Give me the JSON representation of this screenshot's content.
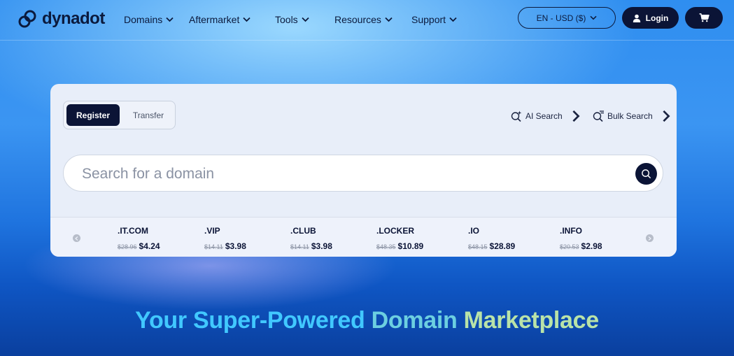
{
  "header": {
    "logo_text": "dynadot",
    "nav": [
      {
        "label": "Domains"
      },
      {
        "label": "Aftermarket"
      },
      {
        "label": "Tools"
      },
      {
        "label": "Resources"
      },
      {
        "label": "Support"
      }
    ],
    "language_currency": "EN - USD ($)",
    "login_label": "Login"
  },
  "search_card": {
    "tabs": {
      "register": "Register",
      "transfer": "Transfer",
      "active": "register"
    },
    "ai_search_label": "AI Search",
    "bulk_search_label": "Bulk Search",
    "search_placeholder": "Search for a domain",
    "tlds": [
      {
        "name": ".IT.COM",
        "old_price": "$28.96",
        "price": "$4.24"
      },
      {
        "name": ".VIP",
        "old_price": "$14.11",
        "price": "$3.98"
      },
      {
        "name": ".CLUB",
        "old_price": "$14.11",
        "price": "$3.98"
      },
      {
        "name": ".LOCKER",
        "old_price": "$48.35",
        "price": "$10.89"
      },
      {
        "name": ".IO",
        "old_price": "$48.15",
        "price": "$28.89"
      },
      {
        "name": ".INFO",
        "old_price": "$20.53",
        "price": "$2.98"
      }
    ]
  },
  "headline": {
    "part1": "Your Super-Powered ",
    "part2": "Domain ",
    "part3": "Marketplace"
  },
  "colors": {
    "navy": "#0b1436",
    "card_bg": "#e8eef9",
    "headline_blue": "#41c8ff",
    "headline_green": "#b9e3a8"
  },
  "icons": [
    "dynadot-logo-icon",
    "chevron-down-icon",
    "user-icon",
    "cart-icon",
    "ai-search-icon",
    "bulk-search-icon",
    "chevron-right-icon",
    "search-icon",
    "arrow-left-icon",
    "arrow-right-icon"
  ]
}
